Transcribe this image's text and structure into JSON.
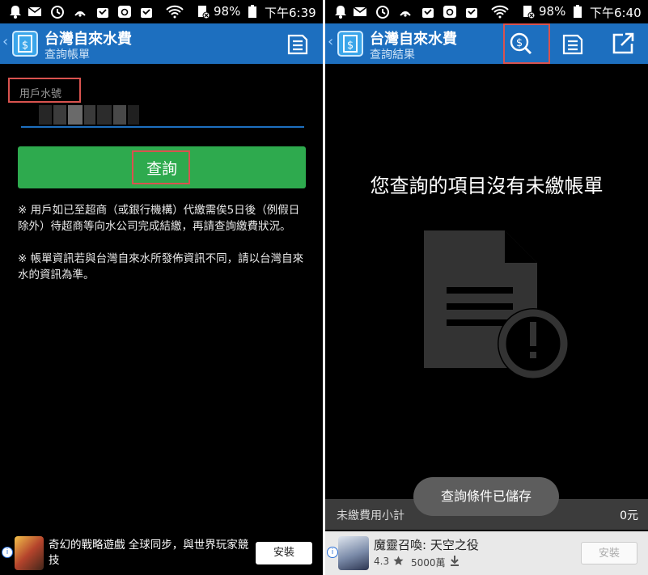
{
  "left": {
    "status": {
      "battery": "98%",
      "time": "下午6:39"
    },
    "appbar": {
      "title": "台灣自來水費",
      "subtitle": "查詢帳單"
    },
    "form": {
      "label": "用戶水號",
      "query_label": "查詢"
    },
    "notes": [
      "※ 用戶如已至超商（或銀行機構）代繳需俟5日後（例假日除外）待超商等向水公司完成結繳，再請查詢繳費狀況。",
      "※ 帳單資訊若與台灣自來水所發佈資訊不同，請以台灣自來水的資訊為準。"
    ],
    "ad": {
      "text": "奇幻的戰略遊戲 全球同步，與世界玩家競技",
      "install": "安裝"
    }
  },
  "right": {
    "status": {
      "battery": "98%",
      "time": "下午6:40"
    },
    "appbar": {
      "title": "台灣自來水費",
      "subtitle": "查詢結果"
    },
    "empty_message": "您查詢的項目沒有未繳帳單",
    "toast": "查詢條件已儲存",
    "subtotal": {
      "label": "未繳費用小計",
      "value": "0元"
    },
    "ad": {
      "title": "魔靈召喚: 天空之役",
      "rating": "4.3",
      "downloads": "5000萬",
      "install": "安裝"
    }
  },
  "icons": {
    "back": "chevron-left-icon",
    "app": "dollar-receipt-icon",
    "list": "list-document-icon",
    "search_money": "search-dollar-icon",
    "share": "open-external-icon",
    "empty": "document-warning-icon",
    "star": "star-icon",
    "download": "download-icon",
    "ad_info": "info-icon"
  },
  "colors": {
    "appbar": "#1d6fbf",
    "query_button": "#2eaa4e",
    "highlight": "#d9534f",
    "toast": "#5d5d5d"
  }
}
